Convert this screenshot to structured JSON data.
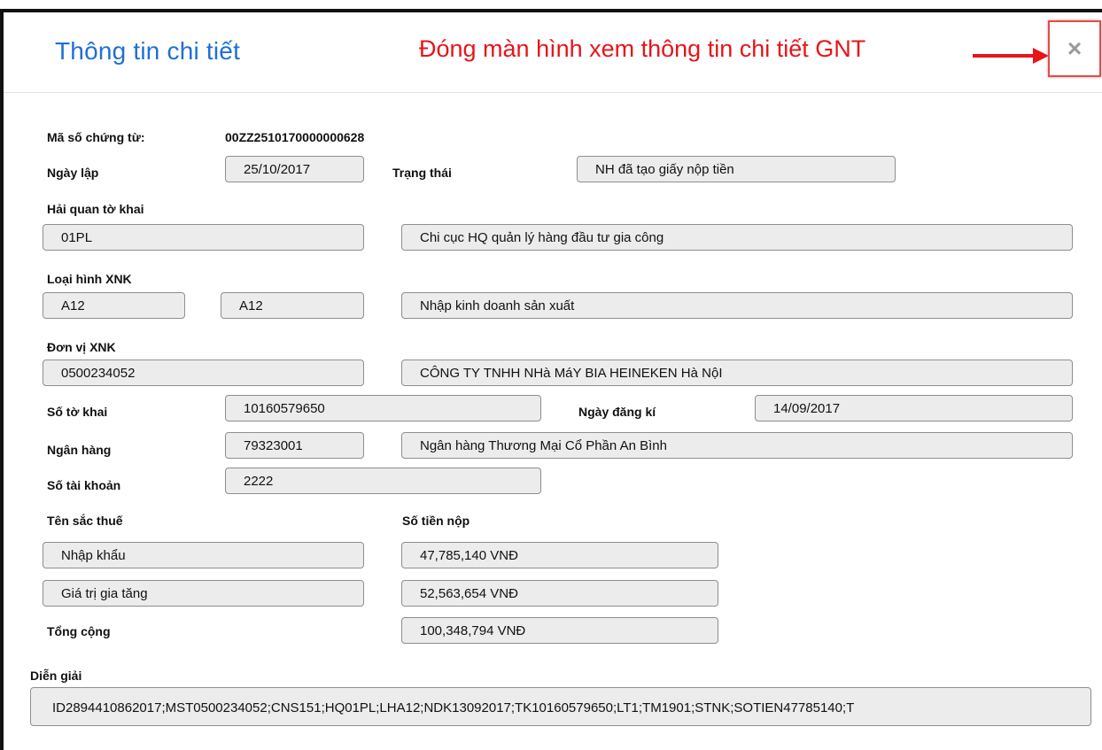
{
  "dialog": {
    "title": "Thông tin chi tiết",
    "close_note": "Đóng màn hình xem thông tin chi tiết GNT",
    "close_glyph": "×"
  },
  "form": {
    "ma_so_chung_tu": {
      "label": "Mã số chứng từ:",
      "value": "00ZZ2510170000000628"
    },
    "ngay_lap": {
      "label": "Ngày lập",
      "value": "25/10/2017"
    },
    "trang_thai": {
      "label": "Trạng thái",
      "value": "NH đã tạo giấy nộp tiền"
    },
    "hai_quan": {
      "label": "Hải quan tờ khai",
      "code": "01PL",
      "name": "Chi cục HQ quản lý hàng đầu tư gia công"
    },
    "loai_hinh": {
      "label": "Loại hình XNK",
      "code1": "A12",
      "code2": "A12",
      "name": "Nhập kinh doanh sản xuất"
    },
    "don_vi": {
      "label": "Đơn vị XNK",
      "code": "0500234052",
      "name": "CÔNG TY TNHH NHà MáY BIA HEINEKEN Hà NộI"
    },
    "so_to_khai": {
      "label": "Số tờ khai",
      "value": "10160579650"
    },
    "ngay_dang_ki": {
      "label": "Ngày đăng kí",
      "value": "14/09/2017"
    },
    "ngan_hang": {
      "label": "Ngân hàng",
      "code": "79323001",
      "name": "Ngân hàng Thương Mại Cổ Phần An Bình"
    },
    "so_tai_khoan": {
      "label": "Số tài khoản",
      "value": "2222"
    },
    "ten_sac_thue_label": "Tên sắc thuế",
    "so_tien_nop_label": "Số tiền nộp",
    "taxes": [
      {
        "name": "Nhập khẩu",
        "amount": "47,785,140 VNĐ"
      },
      {
        "name": "Giá trị gia tăng",
        "amount": "52,563,654 VNĐ"
      }
    ],
    "tong_cong": {
      "label": "Tổng cộng",
      "value": "100,348,794 VNĐ"
    },
    "dien_giai": {
      "label": "Diễn giải",
      "value": "ID2894410862017;MST0500234052;CNS151;HQ01PL;LHA12;NDK13092017;TK10160579650;LT1;TM1901;STNK;SOTIEN47785140;T"
    }
  },
  "colors": {
    "title": "#1f6fd6",
    "note": "#e8141a",
    "close_border": "#e04c4c",
    "field_bg": "#ececec"
  }
}
